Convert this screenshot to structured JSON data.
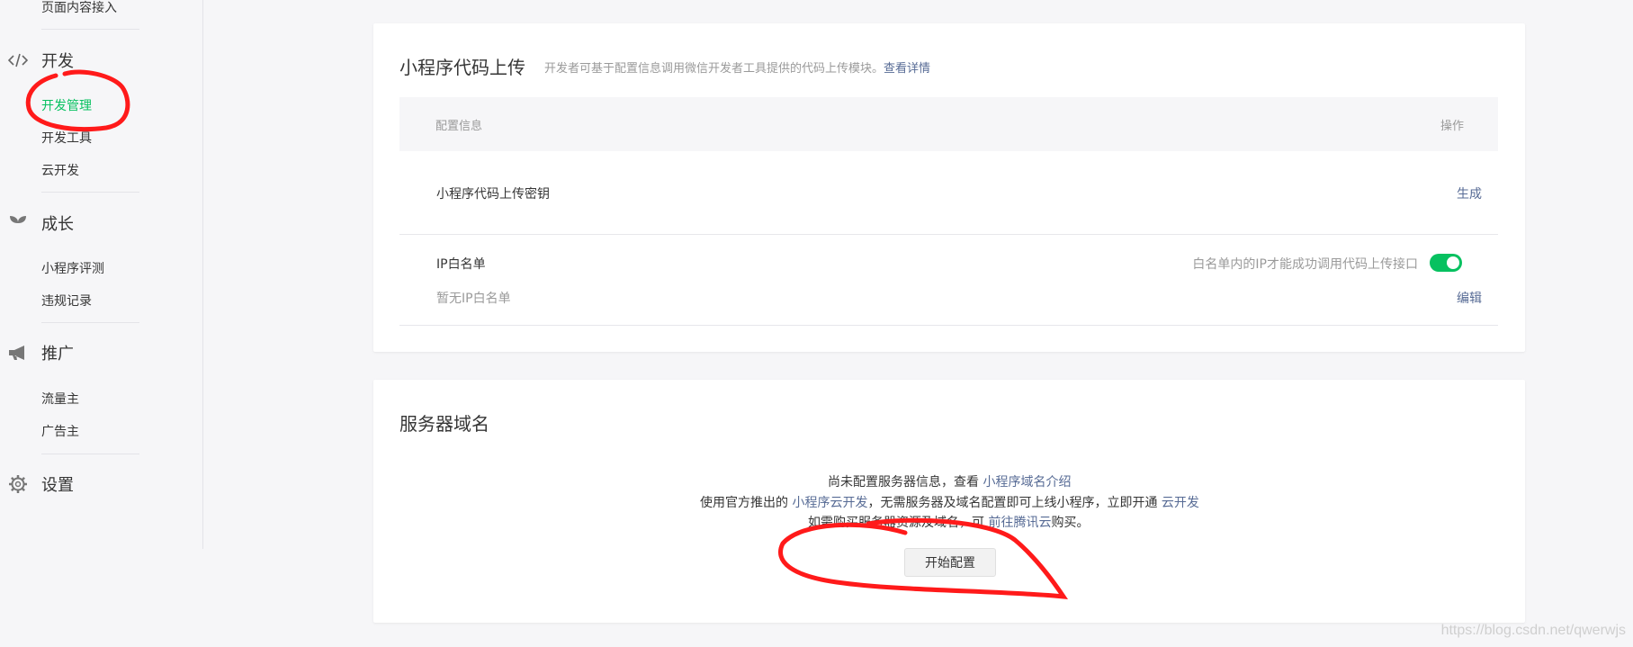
{
  "sidebar": {
    "top_item": "页面内容接入",
    "groups": [
      {
        "icon": "code-icon",
        "label": "开发",
        "items": [
          "开发管理",
          "开发工具",
          "云开发"
        ],
        "active": "开发管理"
      },
      {
        "icon": "sprout-icon",
        "label": "成长",
        "items": [
          "小程序评测",
          "违规记录"
        ]
      },
      {
        "icon": "megaphone-icon",
        "label": "推广",
        "items": [
          "流量主",
          "广告主"
        ]
      },
      {
        "icon": "gear-icon",
        "label": "设置",
        "items": []
      }
    ]
  },
  "upload_card": {
    "title": "小程序代码上传",
    "desc": "开发者可基于配置信息调用微信开发者工具提供的代码上传模块。",
    "desc_link": "查看详情",
    "table": {
      "col_config": "配置信息",
      "col_action": "操作",
      "row1": {
        "label": "小程序代码上传密钥",
        "action": "生成"
      },
      "row2": {
        "label": "IP白名单",
        "hint": "白名单内的IP才能成功调用代码上传接口",
        "toggle_on": true,
        "sub": "暂无IP白名单",
        "action": "编辑"
      }
    }
  },
  "server_card": {
    "title": "服务器域名",
    "line1_pre": "尚未配置服务器信息，查看",
    "line1_link": "小程序域名介绍",
    "line2_pre": "使用官方推出的",
    "line2_link1": "小程序云开发",
    "line2_mid": "，无需服务器及域名配置即可上线小程序，立即开通",
    "line2_link2": "云开发",
    "line3_pre": "如需购买服务器资源及域名，可",
    "line3_link": "前往腾讯云",
    "line3_post": "购买。",
    "button": "开始配置"
  },
  "watermark": "https://blog.csdn.net/qwerwjs",
  "colors": {
    "accent_green": "#07c160",
    "link_blue": "#576b95",
    "annotation_red": "#ff1a1a"
  }
}
